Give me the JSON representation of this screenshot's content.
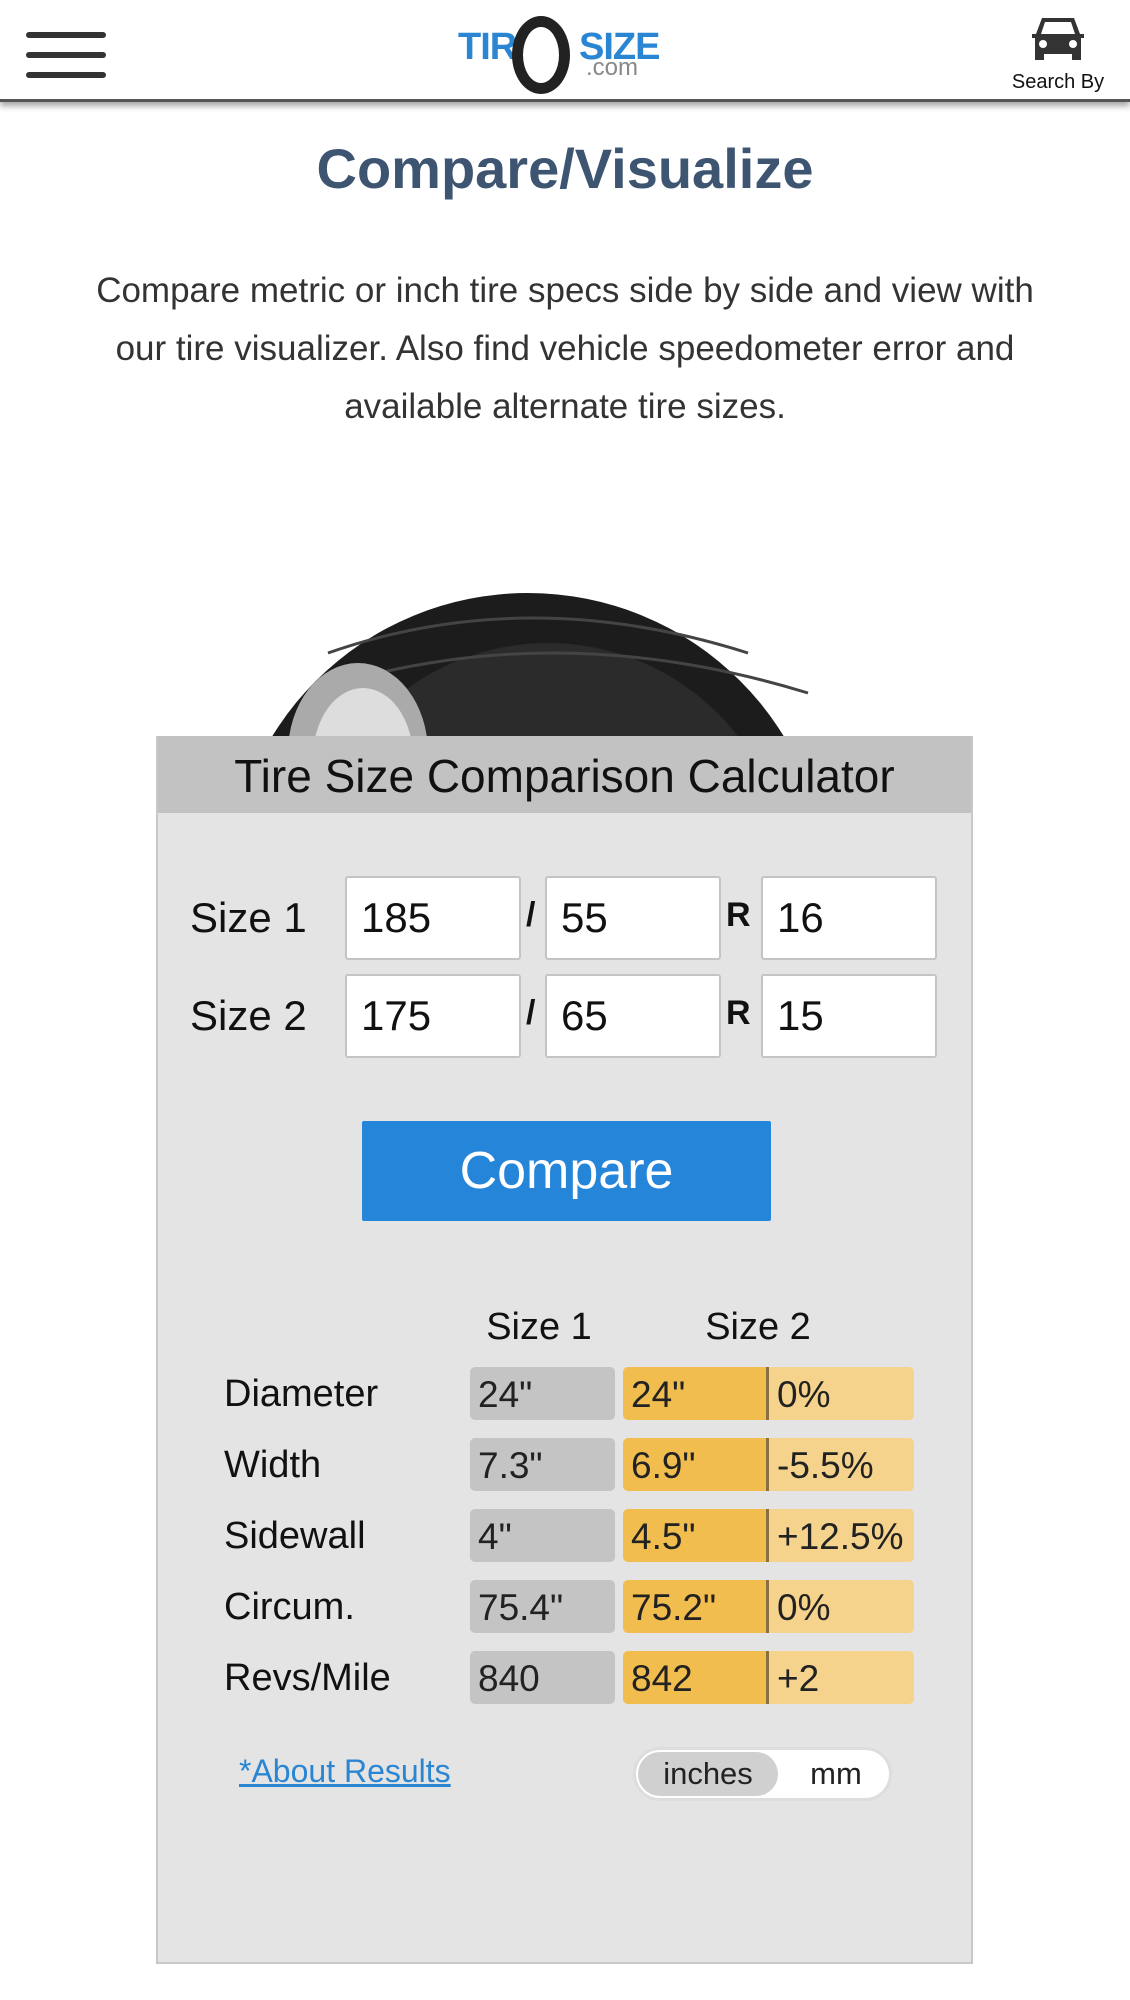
{
  "header": {
    "logo_text": "TIRESIZE.com",
    "search_by": "Search By"
  },
  "page": {
    "title": "Compare/Visualize",
    "intro": "Compare metric or inch tire specs side by side and view with our tire visualizer. Also find vehicle speedometer error and available alternate tire sizes."
  },
  "calculator": {
    "title": "Tire Size Comparison Calculator",
    "sizes": [
      {
        "label": "Size 1",
        "width": "185",
        "aspect": "55",
        "rim": "16"
      },
      {
        "label": "Size 2",
        "width": "175",
        "aspect": "65",
        "rim": "15"
      }
    ],
    "slash": "/",
    "r": "R",
    "compare_label": "Compare",
    "results": {
      "headers": [
        "Size 1",
        "Size 2"
      ],
      "rows": [
        {
          "label": "Diameter",
          "size1": "24\"",
          "size2": "24\"",
          "diff": "0%"
        },
        {
          "label": "Width",
          "size1": "7.3\"",
          "size2": "6.9\"",
          "diff": "-5.5%"
        },
        {
          "label": "Sidewall",
          "size1": "4\"",
          "size2": "4.5\"",
          "diff": "+12.5%"
        },
        {
          "label": "Circum.",
          "size1": "75.4\"",
          "size2": "75.2\"",
          "diff": "0%"
        },
        {
          "label": "Revs/Mile",
          "size1": "840",
          "size2": "842",
          "diff": "+2"
        }
      ]
    },
    "about_link": "*About Results",
    "units": {
      "options": [
        "inches",
        "mm"
      ],
      "selected": "inches"
    }
  },
  "colors": {
    "brand": "#2a86d2",
    "button": "#2585d9",
    "size2": "#f2bd4f",
    "diff": "#f5d38c",
    "size1": "#c4c4c4"
  }
}
